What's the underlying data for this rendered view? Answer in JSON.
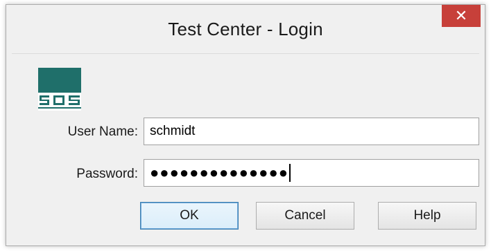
{
  "window": {
    "title": "Test Center - Login",
    "close_glyph": "✕"
  },
  "logo": {
    "icon": "sqs-logo-icon",
    "color": "#1f6f6a"
  },
  "form": {
    "user_label": "User Name:",
    "user_value": "schmidt",
    "password_label": "Password:",
    "password_value": "●●●●●●●●●●●●●●"
  },
  "buttons": {
    "ok": "OK",
    "cancel": "Cancel",
    "help": "Help"
  },
  "colors": {
    "close_button": "#c7403a",
    "dialog_background": "#f0f0f0",
    "default_button_border": "#3c7fb1"
  }
}
